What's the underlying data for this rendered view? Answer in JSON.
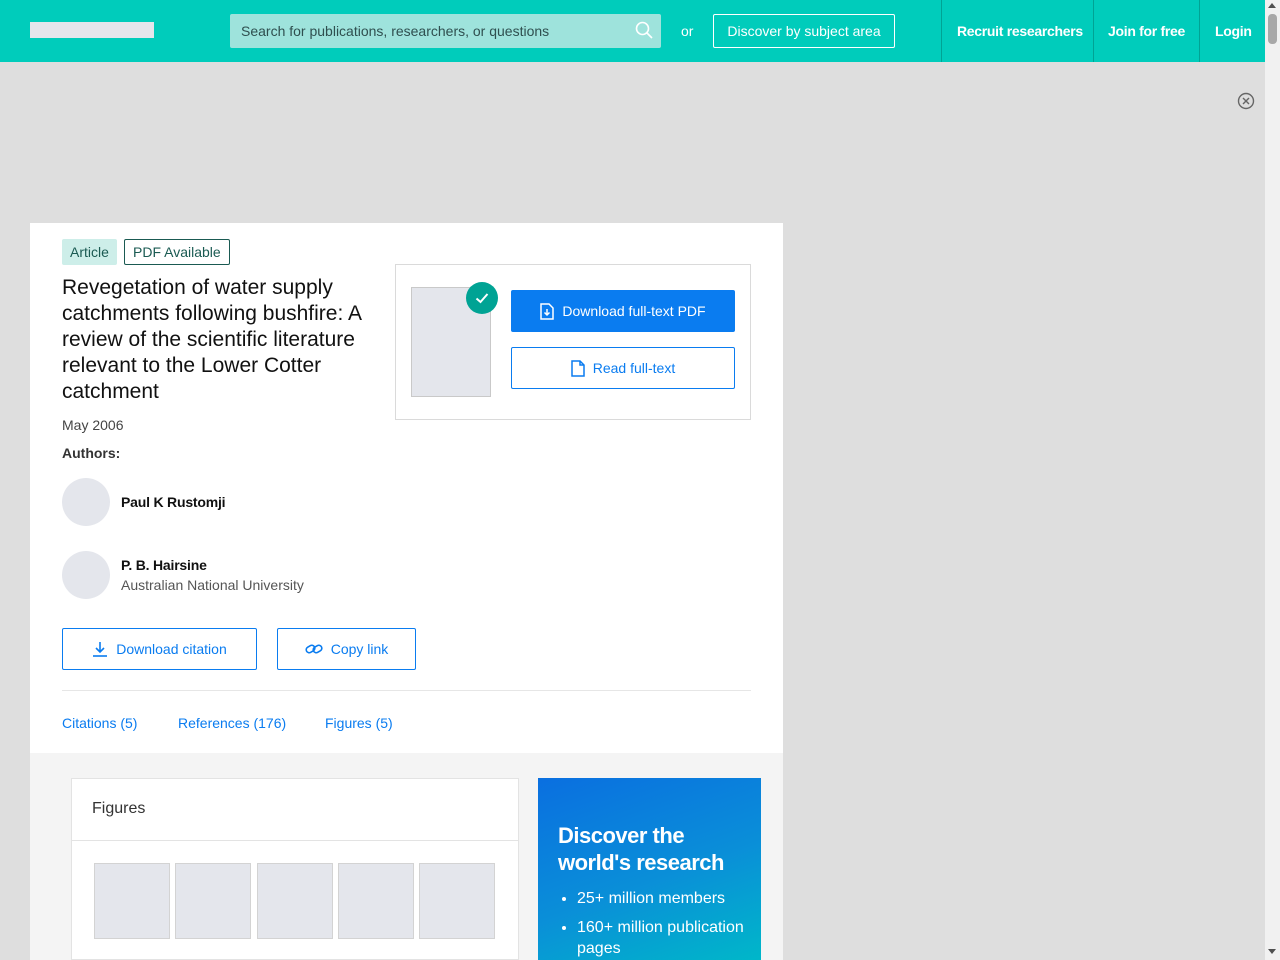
{
  "header": {
    "search_placeholder": "Search for publications, researchers, or questions",
    "or_text": "or",
    "discover_label": "Discover by subject area",
    "nav": [
      "Recruit researchers",
      "Join for free",
      "Login"
    ]
  },
  "article": {
    "badges": [
      "Article",
      "PDF Available"
    ],
    "title": "Revegetation of water supply catchments following bushfire: A review of the scientific literature relevant to the Lower Cotter catchment",
    "date": "May 2006",
    "authors_label": "Authors:",
    "authors": [
      {
        "name": "Paul K Rustomji",
        "institution": ""
      },
      {
        "name": "P. B. Hairsine",
        "institution": "Australian National University"
      }
    ],
    "download_pdf_label": "Download full-text PDF",
    "read_fulltext_label": "Read full-text",
    "download_citation_label": "Download citation",
    "copy_link_label": "Copy link",
    "tabs": [
      "Citations (5)",
      "References (176)",
      "Figures (5)"
    ]
  },
  "figures": {
    "title": "Figures",
    "count": 5
  },
  "promo": {
    "title": "Discover the world's research",
    "bullets": [
      "25+ million members",
      "160+ million publication pages"
    ]
  },
  "colors": {
    "brand_teal": "#00ccbb",
    "primary_blue": "#0a7cf0",
    "check_teal": "#00a394"
  },
  "icons": [
    "search-icon",
    "close-circle-icon",
    "check-icon",
    "pdf-download-icon",
    "document-icon",
    "download-icon",
    "link-icon"
  ]
}
